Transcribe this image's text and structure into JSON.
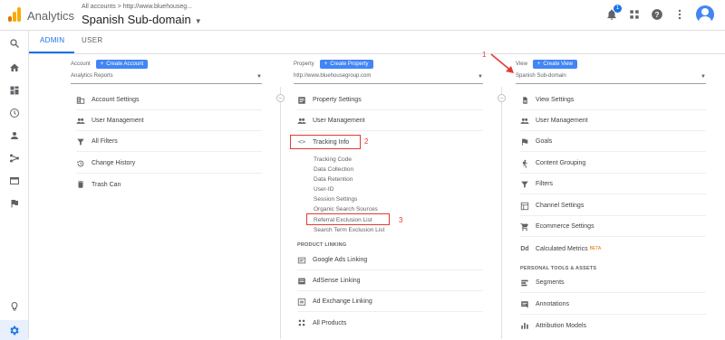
{
  "header": {
    "app_name": "Analytics",
    "account_line": "All accounts > http://www.bluehouseg...",
    "account_title": "Spanish Sub-domain",
    "notification_count": "1"
  },
  "tabs": {
    "admin": "ADMIN",
    "user": "USER"
  },
  "account": {
    "label": "Account",
    "create_button": "Create Account",
    "selected": "Analytics Reports",
    "items": [
      "Account Settings",
      "User Management",
      "All Filters",
      "Change History",
      "Trash Can"
    ]
  },
  "property": {
    "label": "Property",
    "create_button": "Create Property",
    "selected": "http://www.bluehousegroup.com",
    "items": [
      "Property Settings",
      "User Management",
      "Tracking Info"
    ],
    "tracking_sub": [
      "Tracking Code",
      "Data Collection",
      "Data Retention",
      "User-ID",
      "Session Settings",
      "Organic Search Sources",
      "Referral Exclusion List",
      "Search Term Exclusion List"
    ],
    "product_linking_header": "PRODUCT LINKING",
    "linking_items": [
      "Google Ads Linking",
      "AdSense Linking",
      "Ad Exchange Linking",
      "All Products"
    ]
  },
  "view": {
    "label": "View",
    "create_button": "Create View",
    "selected": "Spanish Sub-domain",
    "items": [
      "View Settings",
      "User Management",
      "Goals",
      "Content Grouping",
      "Filters",
      "Channel Settings",
      "Ecommerce Settings",
      "Calculated Metrics"
    ],
    "beta_badge": "BETA",
    "personal_header": "PERSONAL TOOLS & ASSETS",
    "personal_items": [
      "Segments",
      "Annotations",
      "Attribution Models"
    ]
  },
  "annotations": {
    "one": "1",
    "two": "2",
    "three": "3"
  },
  "colors": {
    "accent": "#1a73e8",
    "button": "#4285f4",
    "annotation": "#e53935",
    "logo_orange": "#f9ab00",
    "logo_dark": "#e37400"
  }
}
